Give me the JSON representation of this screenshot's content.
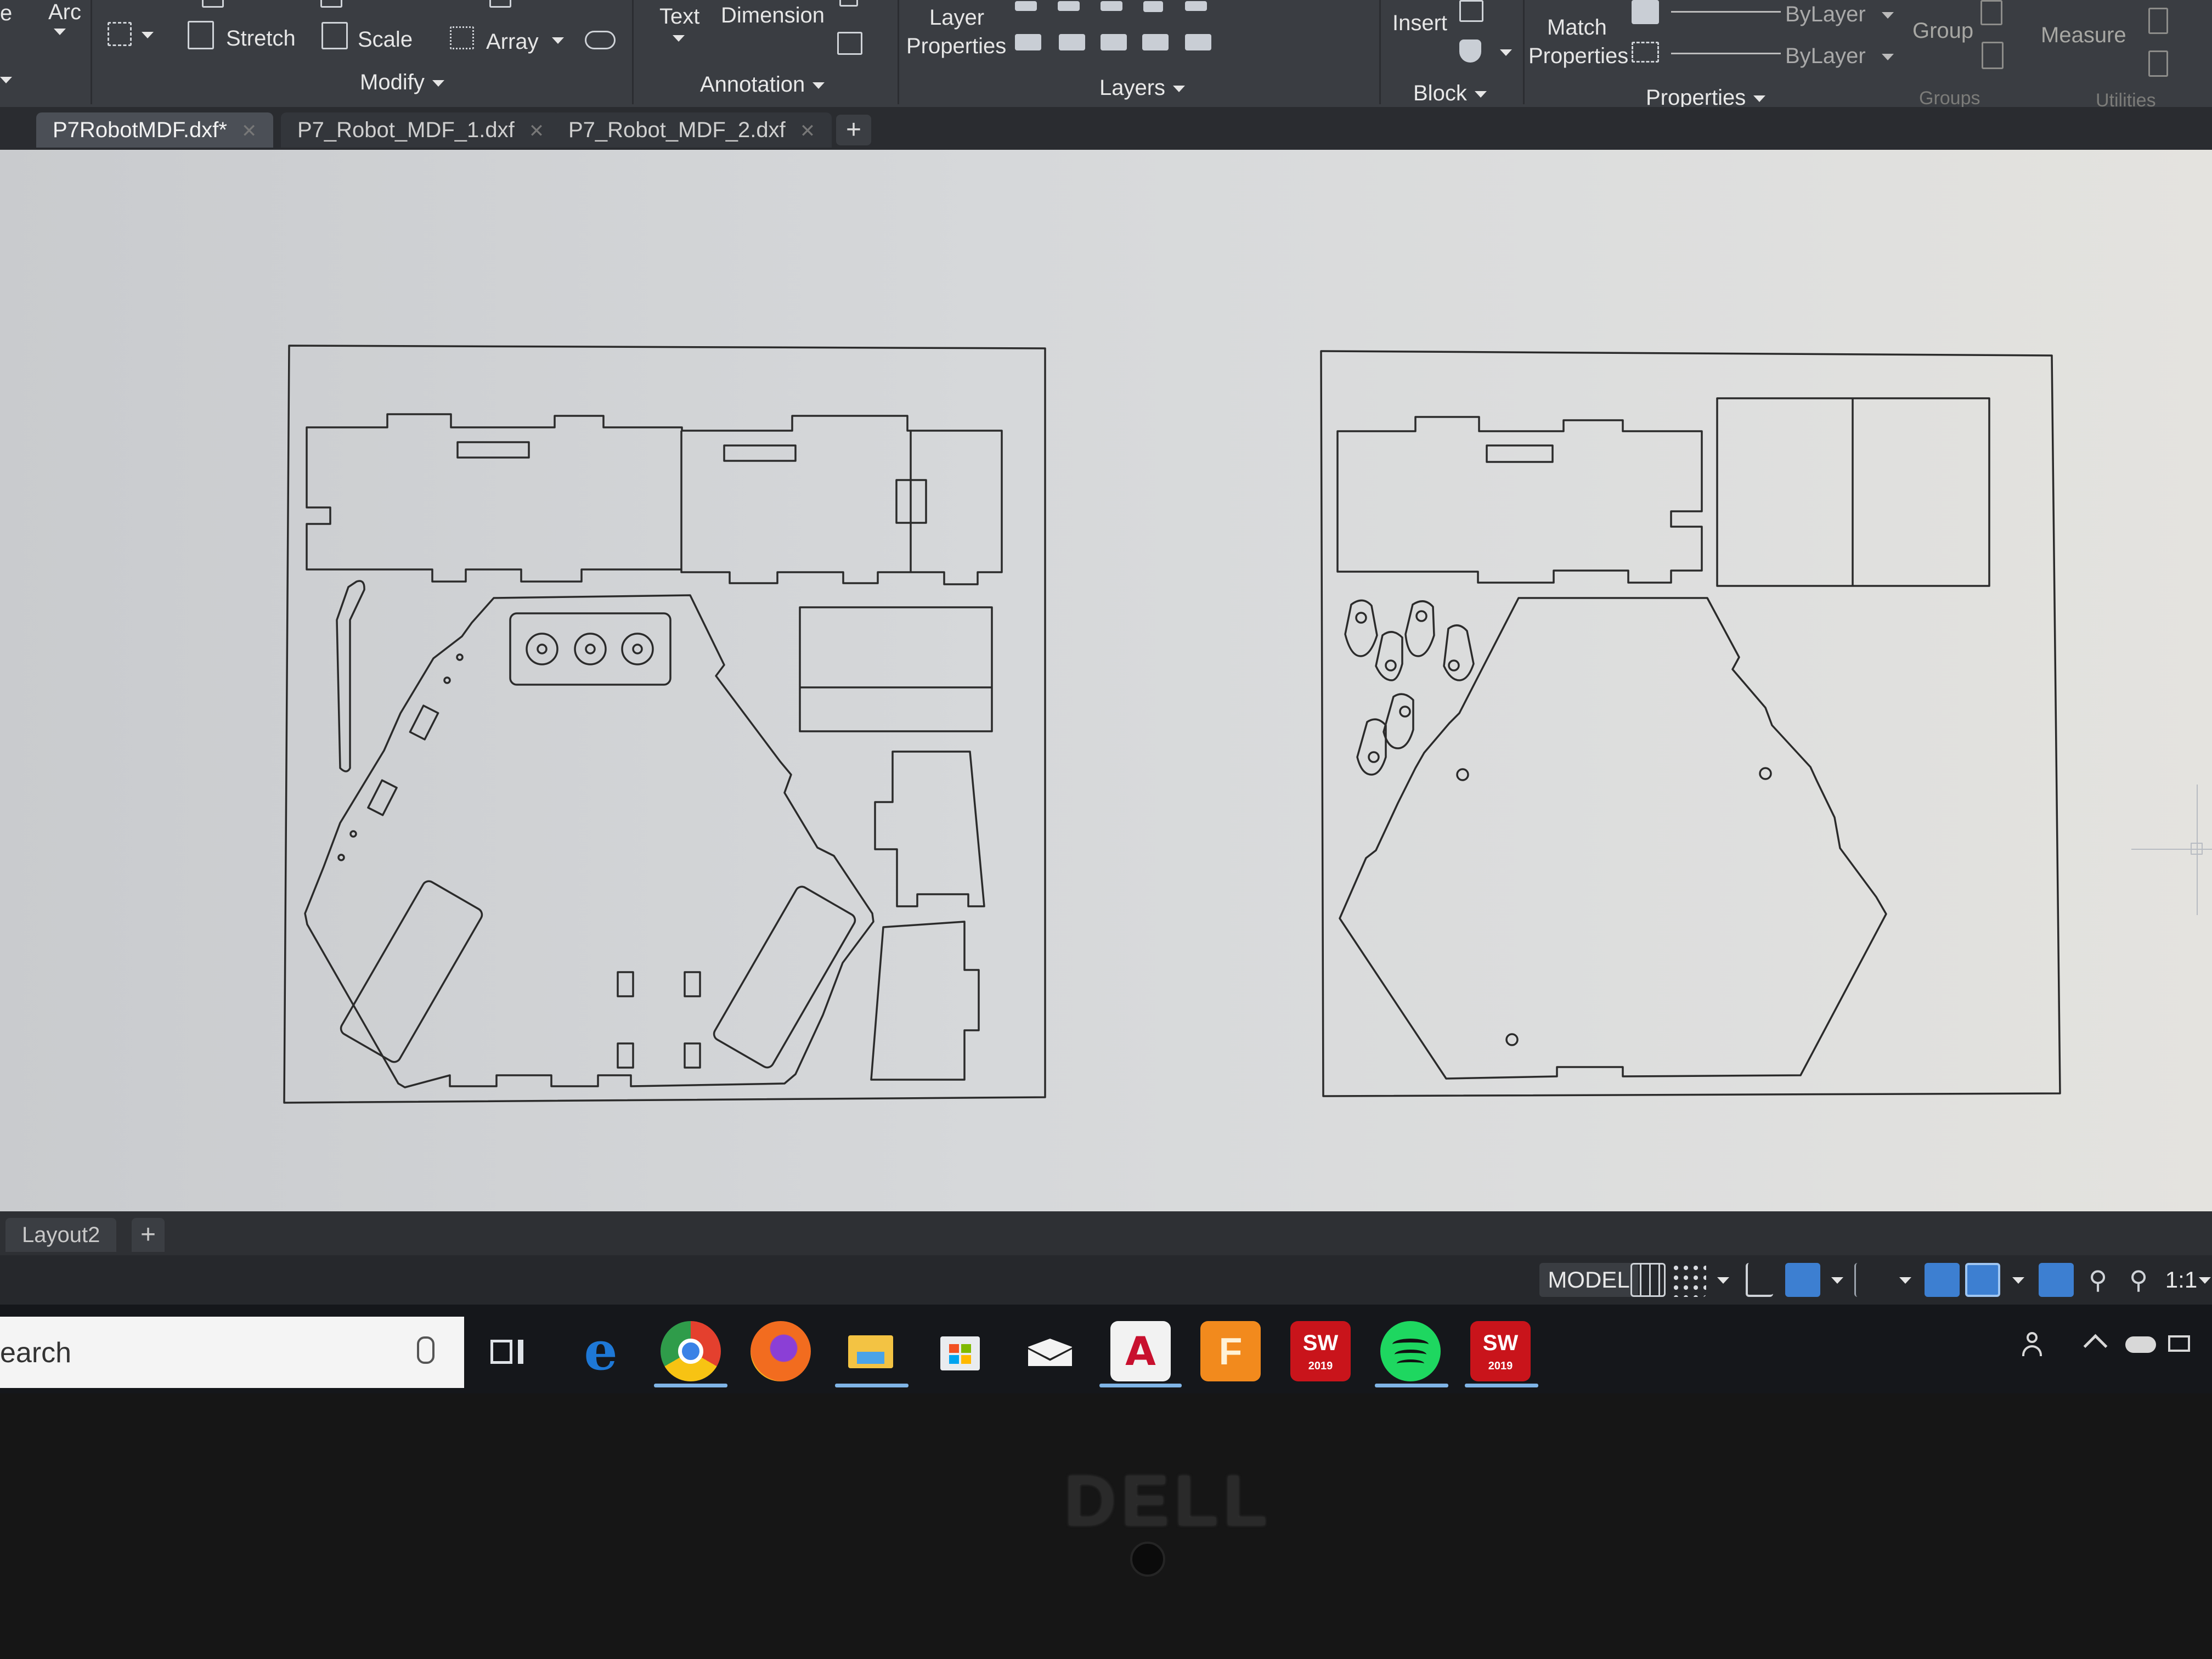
{
  "ribbon": {
    "draw": {
      "arc_label": "Arc"
    },
    "modify": {
      "stretch_label": "Stretch",
      "scale_label": "Scale",
      "array_label": "Array",
      "title": "Modify"
    },
    "annotation": {
      "text_label": "Text",
      "dimension_label": "Dimension",
      "title": "Annotation"
    },
    "layers": {
      "layer_properties_line1": "Layer",
      "layer_properties_line2": "Properties",
      "title": "Layers"
    },
    "block": {
      "insert_label": "Insert",
      "title": "Block"
    },
    "properties": {
      "match_line1": "Match",
      "match_line2": "Properties",
      "color_value": "ByLayer",
      "linetype_value": "ByLayer",
      "title": "Properties"
    },
    "groups": {
      "group_label": "Group",
      "title": "Groups"
    },
    "utilities": {
      "measure_label": "Measure",
      "title": "Utilities"
    }
  },
  "tabs": [
    {
      "label": "P7RobotMDF.dxf*",
      "active": true
    },
    {
      "label": "P7_Robot_MDF_1.dxf",
      "active": false
    },
    {
      "label": "P7_Robot_MDF_2.dxf",
      "active": false
    }
  ],
  "layout_tabs": {
    "current": "Layout2"
  },
  "status_bar": {
    "mode": "MODEL",
    "scale": "1:1"
  },
  "taskbar": {
    "search_text": "earch",
    "apps": [
      {
        "name": "task-view",
        "active": false
      },
      {
        "name": "edge",
        "active": false
      },
      {
        "name": "chrome",
        "active": true
      },
      {
        "name": "firefox",
        "active": false
      },
      {
        "name": "file-explorer",
        "active": true
      },
      {
        "name": "microsoft-store",
        "active": false
      },
      {
        "name": "mail",
        "active": false
      },
      {
        "name": "autocad",
        "active": true
      },
      {
        "name": "fusion",
        "active": false
      },
      {
        "name": "solidworks-2019",
        "active": false
      },
      {
        "name": "spotify",
        "active": true
      },
      {
        "name": "solidworks-2019-b",
        "active": true
      }
    ],
    "solidworks_badge": "SW",
    "solidworks_year": "2019",
    "autocad_letter": "A",
    "fusion_letter": "F"
  },
  "laptop": {
    "brand": "DELL"
  },
  "colors": {
    "ribbon_bg": "#3a3d42",
    "accent_blue": "#3d7fd1",
    "canvas_bg": "#d6d8da",
    "line": "#2b2b2b"
  }
}
